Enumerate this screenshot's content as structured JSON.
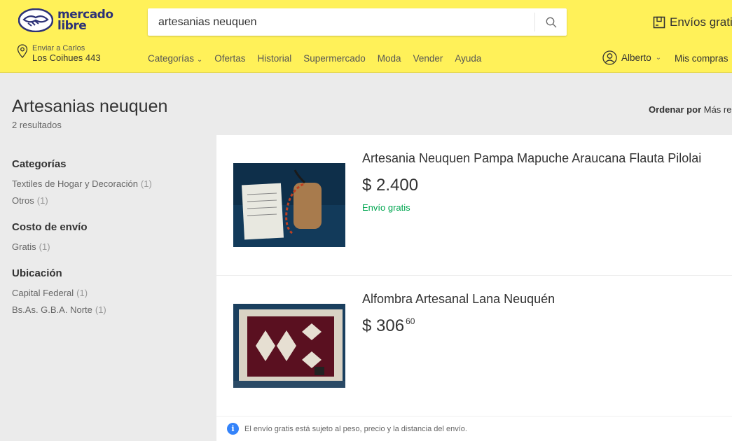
{
  "header": {
    "logo_line1": "mercado",
    "logo_line2": "libre",
    "search_value": "artesanias neuquen",
    "envios_label": "Envíos gratis",
    "address_label": "Enviar a Carlos",
    "address_value": "Los Coihues 443",
    "nav": [
      "Categorías",
      "Ofertas",
      "Historial",
      "Supermercado",
      "Moda",
      "Vender",
      "Ayuda"
    ],
    "user_name": "Alberto",
    "my_purchases": "Mis compras"
  },
  "page": {
    "title": "Artesanias neuquen",
    "results_count": "2 resultados",
    "sort_label": "Ordenar por",
    "sort_value": "Más relevantes"
  },
  "filters": [
    {
      "title": "Categorías",
      "items": [
        {
          "label": "Textiles de Hogar y Decoración",
          "count": "(1)"
        },
        {
          "label": "Otros",
          "count": "(1)"
        }
      ]
    },
    {
      "title": "Costo de envío",
      "items": [
        {
          "label": "Gratis",
          "count": "(1)"
        }
      ]
    },
    {
      "title": "Ubicación",
      "items": [
        {
          "label": "Capital Federal",
          "count": "(1)"
        },
        {
          "label": "Bs.As. G.B.A. Norte",
          "count": "(1)"
        }
      ]
    }
  ],
  "results": [
    {
      "title": "Artesania Neuquen Pampa Mapuche Araucana Flauta Pilolai",
      "currency": "$",
      "price": "2.400",
      "cents": "",
      "shipping": "Envío gratis"
    },
    {
      "title": "Alfombra Artesanal Lana Neuquén",
      "currency": "$",
      "price": "306",
      "cents": "60",
      "shipping": ""
    }
  ],
  "footnote": "El envío gratis está sujeto al peso, precio y la distancia del envío.",
  "colors": {
    "header_bg": "#fff159",
    "free_shipping": "#00a650",
    "info": "#3483fa"
  }
}
